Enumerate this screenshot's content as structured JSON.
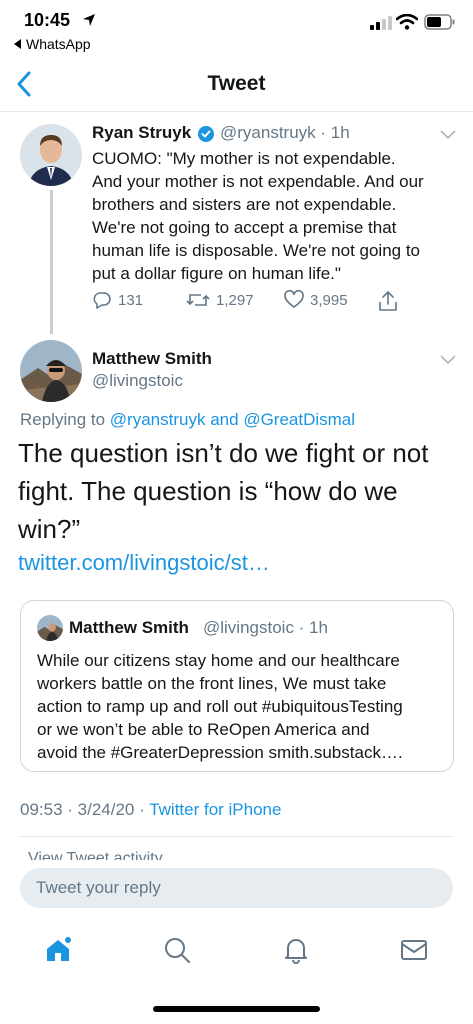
{
  "status_bar": {
    "time": "10:45",
    "back_app": "WhatsApp"
  },
  "nav": {
    "title": "Tweet",
    "back_icon": "chevron-left-icon"
  },
  "parent_tweet": {
    "name": "Ryan Struyk",
    "handle": "@ryanstruyk",
    "time": "· 1h",
    "verified": true,
    "body": "CUOMO: \"My mother is not expendable.\nAnd your mother is not expendable. And our\nbrothers and sisters are not expendable.\nWe're not going to accept a premise that\nhuman life is disposable. We're not going to\nput a dollar figure on human life.\"",
    "replies": "131",
    "retweets": "1,297",
    "likes": "3,995"
  },
  "main_tweet": {
    "name": "Matthew Smith",
    "handle": "@livingstoic",
    "replying_prefix": "Replying to",
    "replying_user1": "@ryanstruyk",
    "replying_and": "and",
    "replying_user2": "@GreatDismal",
    "body": "The question isn’t do we fight or not fight. The question is “how do we win?”",
    "link": "twitter.com/livingstoic/st…",
    "timestamp": "09:53 · 3/24/20 ·",
    "source": "Twitter for iPhone"
  },
  "quoted_tweet": {
    "name": "Matthew Smith",
    "handle": "@livingstoic · 1h",
    "body": "While our citizens stay home and our healthcare\nworkers battle on the front lines, We must take\naction to ramp up and roll out #ubiquitousTesting\nor we won’t be able to ReOpen America and\navoid the #GreaterDepression  smith.substack…."
  },
  "activity_partial": "View Tweet activity",
  "reply": {
    "placeholder": "Tweet your reply"
  },
  "tabs": [
    {
      "icon": "home-icon",
      "active": true
    },
    {
      "icon": "search-icon",
      "active": false
    },
    {
      "icon": "notifications-bell-icon",
      "active": false
    },
    {
      "icon": "messages-envelope-icon",
      "active": false
    }
  ],
  "colors": {
    "accent": "#1b95e0",
    "text": "#14171a",
    "secondary": "#657786",
    "border": "#e1e8ed"
  }
}
